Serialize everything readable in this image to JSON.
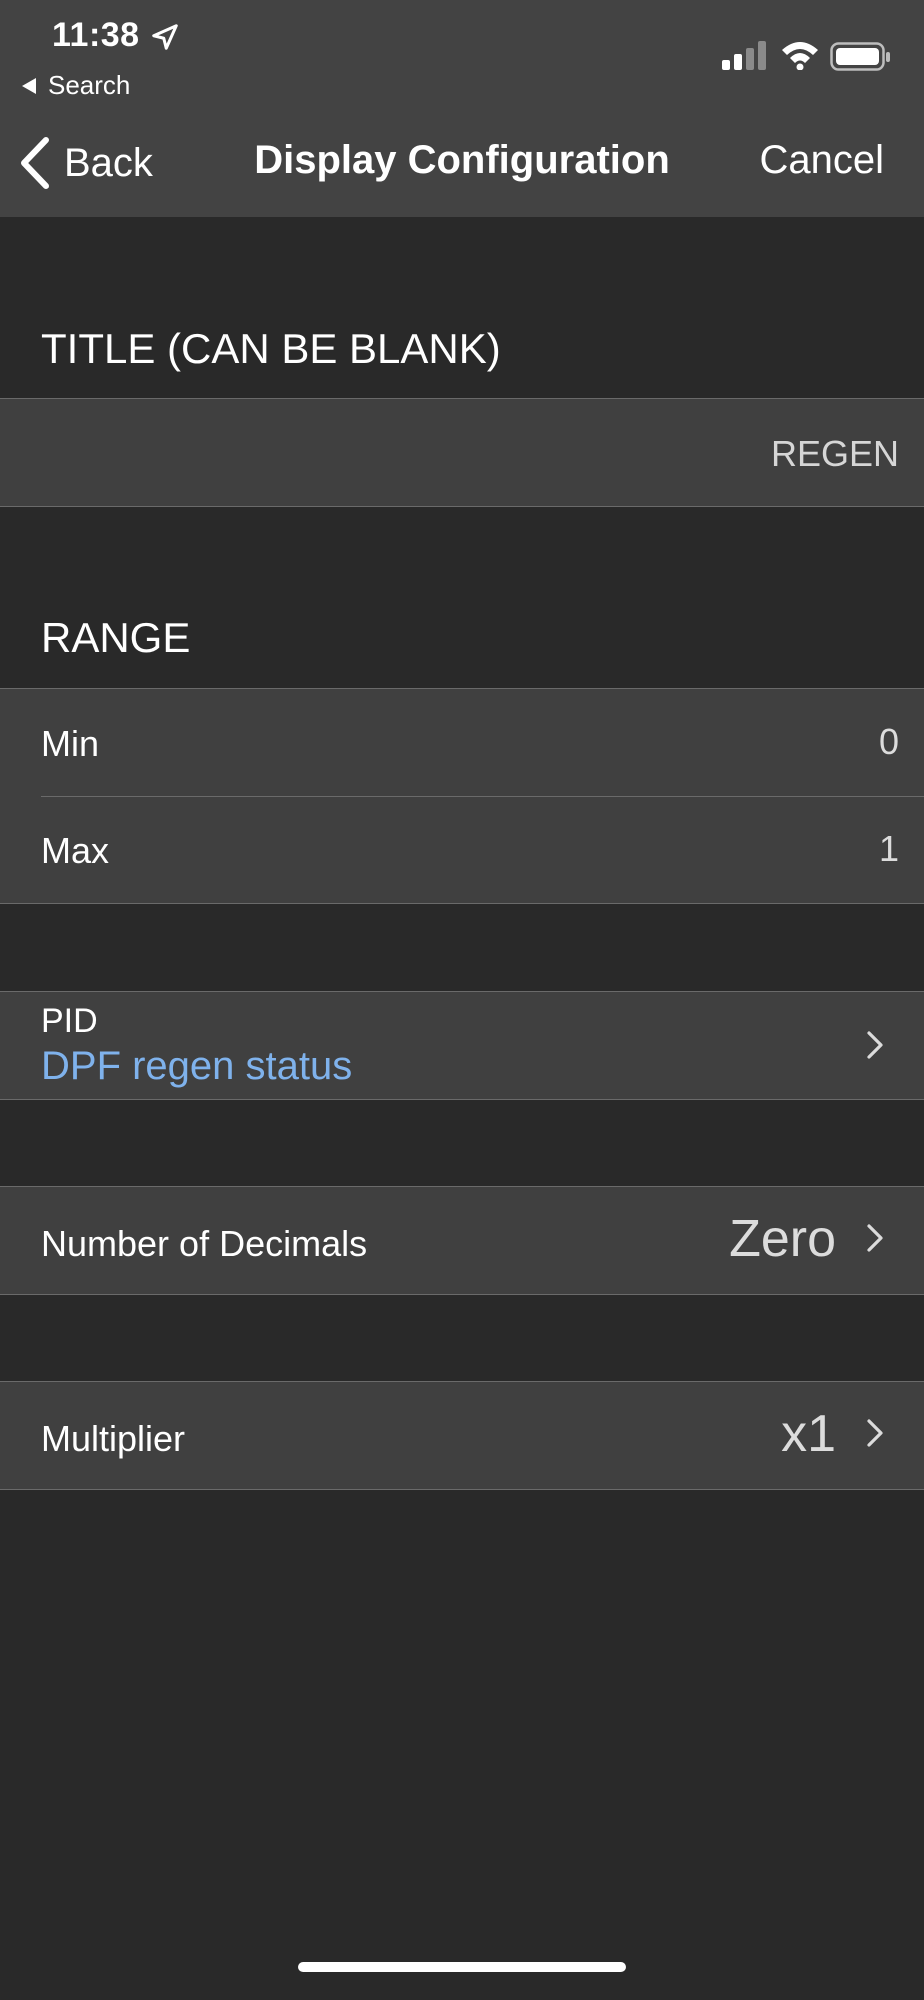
{
  "status_bar": {
    "time": "11:38",
    "back_app": "Search"
  },
  "nav": {
    "back_label": "Back",
    "title": "Display Configuration",
    "cancel_label": "Cancel"
  },
  "title_section": {
    "header": "TITLE (CAN BE BLANK)",
    "value": "REGEN"
  },
  "range_section": {
    "header": "RANGE",
    "min_label": "Min",
    "min_value": "0",
    "max_label": "Max",
    "max_value": "1"
  },
  "pid": {
    "label": "PID",
    "value": "DPF regen status",
    "value_color": "#7fb2ec"
  },
  "decimals": {
    "label": "Number of Decimals",
    "value": "Zero"
  },
  "multiplier": {
    "label": "Multiplier",
    "value": "x1"
  },
  "colors": {
    "header_bg": "#434343",
    "body_bg": "#292929",
    "row_bg": "#404040"
  }
}
